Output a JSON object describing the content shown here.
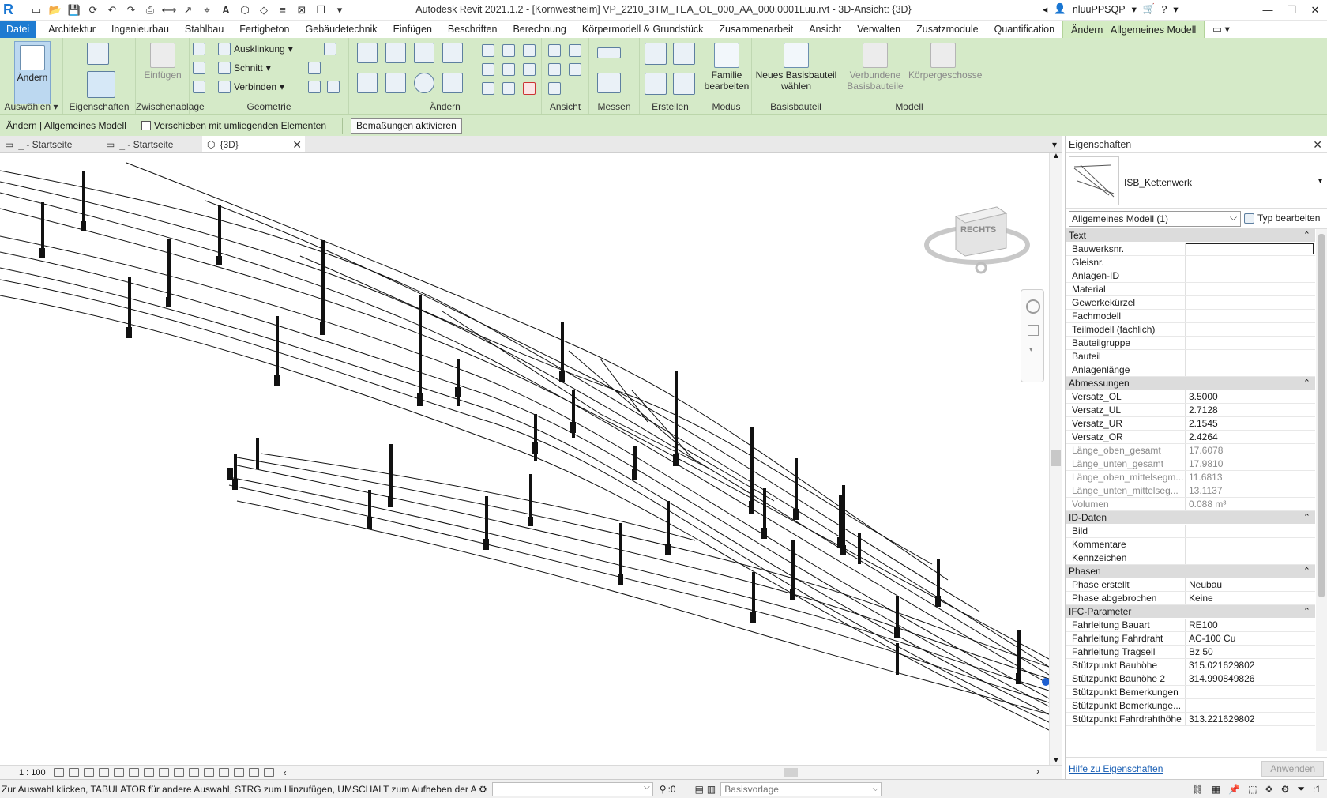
{
  "title": "Autodesk Revit 2021.1.2 - [Kornwestheim] VP_2210_3TM_TEA_OL_000_AA_000.0001Luu.rvt - 3D-Ansicht: {3D}",
  "app_logo": "R",
  "user": {
    "name": "nluuPPSQP"
  },
  "ribbon_tabs": [
    "Datei",
    "Architektur",
    "Ingenieurbau",
    "Stahlbau",
    "Fertigbeton",
    "Gebäudetechnik",
    "Einfügen",
    "Beschriften",
    "Berechnung",
    "Körpermodell & Grundstück",
    "Zusammenarbeit",
    "Ansicht",
    "Verwalten",
    "Zusatzmodule",
    "Quantification",
    "Ändern | Allgemeines Modell"
  ],
  "ribbon": {
    "aendern": "Ändern",
    "auswaehlen": "Auswählen",
    "eigenschaften": "Eigenschaften",
    "einfuegen": "Einfügen",
    "zwischenablage": "Zwischenablage",
    "ausklinkung": "Ausklinkung",
    "schnitt": "Schnitt",
    "verbinden": "Verbinden",
    "geometrie": "Geometrie",
    "aendern_panel": "Ändern",
    "ansicht": "Ansicht",
    "messen": "Messen",
    "erstellen": "Erstellen",
    "familie_bearbeiten": "Familie bearbeiten",
    "modus": "Modus",
    "neues_basisbauteil": "Neues Basisbauteil wählen",
    "basisbauteil": "Basisbauteil",
    "verbundene_basisbauteile": "Verbundene Basisbauteile",
    "koerpergeschosse": "Körpergeschosse",
    "modell": "Modell"
  },
  "optionsbar": {
    "context": "Ändern | Allgemeines Modell",
    "checkbox_label": "Verschieben mit umliegenden Elementen",
    "button": "Bemaßungen aktivieren"
  },
  "view_tabs": [
    {
      "label": "_ - Startseite"
    },
    {
      "label": "_ - Startseite"
    },
    {
      "label": "{3D}"
    }
  ],
  "viewcube_label": "RECHTS",
  "scale": "1 : 100",
  "properties": {
    "header": "Eigenschaften",
    "type_name": "ISB_Kettenwerk",
    "instance_filter": "Allgemeines Modell (1)",
    "edit_type": "Typ bearbeiten",
    "groups": [
      {
        "name": "Text",
        "rows": [
          {
            "n": "Bauwerksnr.",
            "v": ""
          },
          {
            "n": "Gleisnr.",
            "v": ""
          },
          {
            "n": "Anlagen-ID",
            "v": ""
          },
          {
            "n": "Material",
            "v": ""
          },
          {
            "n": "Gewerkekürzel",
            "v": ""
          },
          {
            "n": "Fachmodell",
            "v": ""
          },
          {
            "n": "Teilmodell (fachlich)",
            "v": ""
          },
          {
            "n": "Bauteilgruppe",
            "v": ""
          },
          {
            "n": "Bauteil",
            "v": ""
          },
          {
            "n": "Anlagenlänge",
            "v": ""
          }
        ]
      },
      {
        "name": "Abmessungen",
        "rows": [
          {
            "n": "Versatz_OL",
            "v": "3.5000"
          },
          {
            "n": "Versatz_UL",
            "v": "2.7128"
          },
          {
            "n": "Versatz_UR",
            "v": "2.1545"
          },
          {
            "n": "Versatz_OR",
            "v": "2.4264"
          },
          {
            "n": "Länge_oben_gesamt",
            "v": "17.6078",
            "ro": true
          },
          {
            "n": "Länge_unten_gesamt",
            "v": "17.9810",
            "ro": true
          },
          {
            "n": "Länge_oben_mittelsegm...",
            "v": "11.6813",
            "ro": true
          },
          {
            "n": "Länge_unten_mittelseg...",
            "v": "13.1137",
            "ro": true
          },
          {
            "n": "Volumen",
            "v": "0.088 m³",
            "ro": true
          }
        ]
      },
      {
        "name": "ID-Daten",
        "rows": [
          {
            "n": "Bild",
            "v": ""
          },
          {
            "n": "Kommentare",
            "v": ""
          },
          {
            "n": "Kennzeichen",
            "v": ""
          }
        ]
      },
      {
        "name": "Phasen",
        "rows": [
          {
            "n": "Phase erstellt",
            "v": "Neubau"
          },
          {
            "n": "Phase abgebrochen",
            "v": "Keine"
          }
        ]
      },
      {
        "name": "IFC-Parameter",
        "rows": [
          {
            "n": "Fahrleitung Bauart",
            "v": "RE100"
          },
          {
            "n": "Fahrleitung Fahrdraht",
            "v": "AC-100 Cu"
          },
          {
            "n": "Fahrleitung Tragseil",
            "v": "Bz 50"
          },
          {
            "n": "Stützpunkt Bauhöhe",
            "v": "315.021629802"
          },
          {
            "n": "Stützpunkt Bauhöhe 2",
            "v": "314.990849826"
          },
          {
            "n": "Stützpunkt Bemerkungen",
            "v": ""
          },
          {
            "n": "Stützpunkt Bemerkunge...",
            "v": ""
          },
          {
            "n": "Stützpunkt Fahrdrahthöhe",
            "v": "313.221629802"
          }
        ]
      }
    ],
    "help_link": "Hilfe zu Eigenschaften",
    "apply": "Anwenden"
  },
  "status": {
    "message": "Zur Auswahl klicken, TABULATOR für andere Auswahl, STRG zum Hinzufügen, UMSCHALT zum Aufheben der Ausw",
    "count": ":0",
    "template": "Basisvorlage",
    "filter_count": ":1"
  }
}
